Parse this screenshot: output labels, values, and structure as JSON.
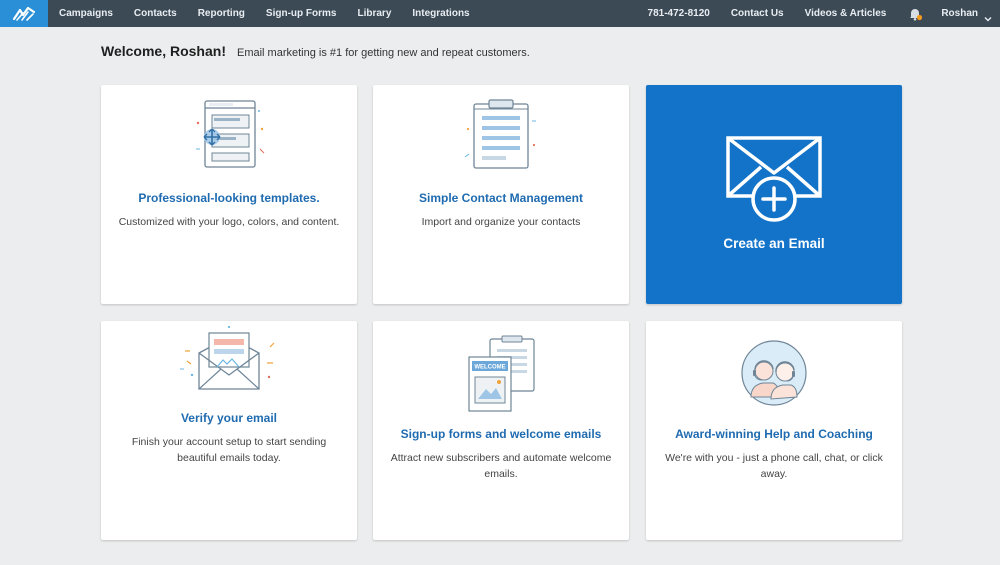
{
  "nav": {
    "left": [
      {
        "label": "Campaigns",
        "name": "nav-campaigns"
      },
      {
        "label": "Contacts",
        "name": "nav-contacts"
      },
      {
        "label": "Reporting",
        "name": "nav-reporting"
      },
      {
        "label": "Sign-up Forms",
        "name": "nav-signup-forms"
      },
      {
        "label": "Library",
        "name": "nav-library"
      },
      {
        "label": "Integrations",
        "name": "nav-integrations"
      }
    ],
    "phone": "781-472-8120",
    "contact_us": "Contact Us",
    "videos": "Videos & Articles",
    "user": "Roshan",
    "icons": {
      "logo": "brand-logo-icon",
      "bell": "bell-icon",
      "user_menu": "chevron-down-icon"
    },
    "colors": {
      "bar": "#3c4a56",
      "logo_bg": "#2a8fd6",
      "notification_dot": "#f39a1e"
    }
  },
  "welcome": {
    "title": "Welcome, Roshan!",
    "subtitle": "Email marketing is #1 for getting new and repeat customers."
  },
  "cards": {
    "templates": {
      "title": "Professional-looking templates.",
      "desc": "Customized with your logo, colors, and content.",
      "icon": "template-layout-icon"
    },
    "contacts": {
      "title": "Simple Contact Management",
      "desc": "Import and organize your contacts",
      "icon": "clipboard-list-icon"
    },
    "create": {
      "label": "Create an Email",
      "icon": "envelope-plus-icon",
      "color": "#1273c9"
    },
    "verify": {
      "title": "Verify your email",
      "desc": "Finish your account setup to start sending beautiful emails today.",
      "icon": "open-envelope-icon"
    },
    "signup": {
      "title": "Sign-up forms and welcome emails",
      "desc": "Attract new subscribers and automate welcome emails.",
      "icon": "signup-form-icon",
      "form_badge": "WELCOME"
    },
    "help": {
      "title": "Award-winning Help and Coaching",
      "desc": "We're with you - just a phone call, chat, or click away.",
      "icon": "support-agents-icon"
    }
  }
}
